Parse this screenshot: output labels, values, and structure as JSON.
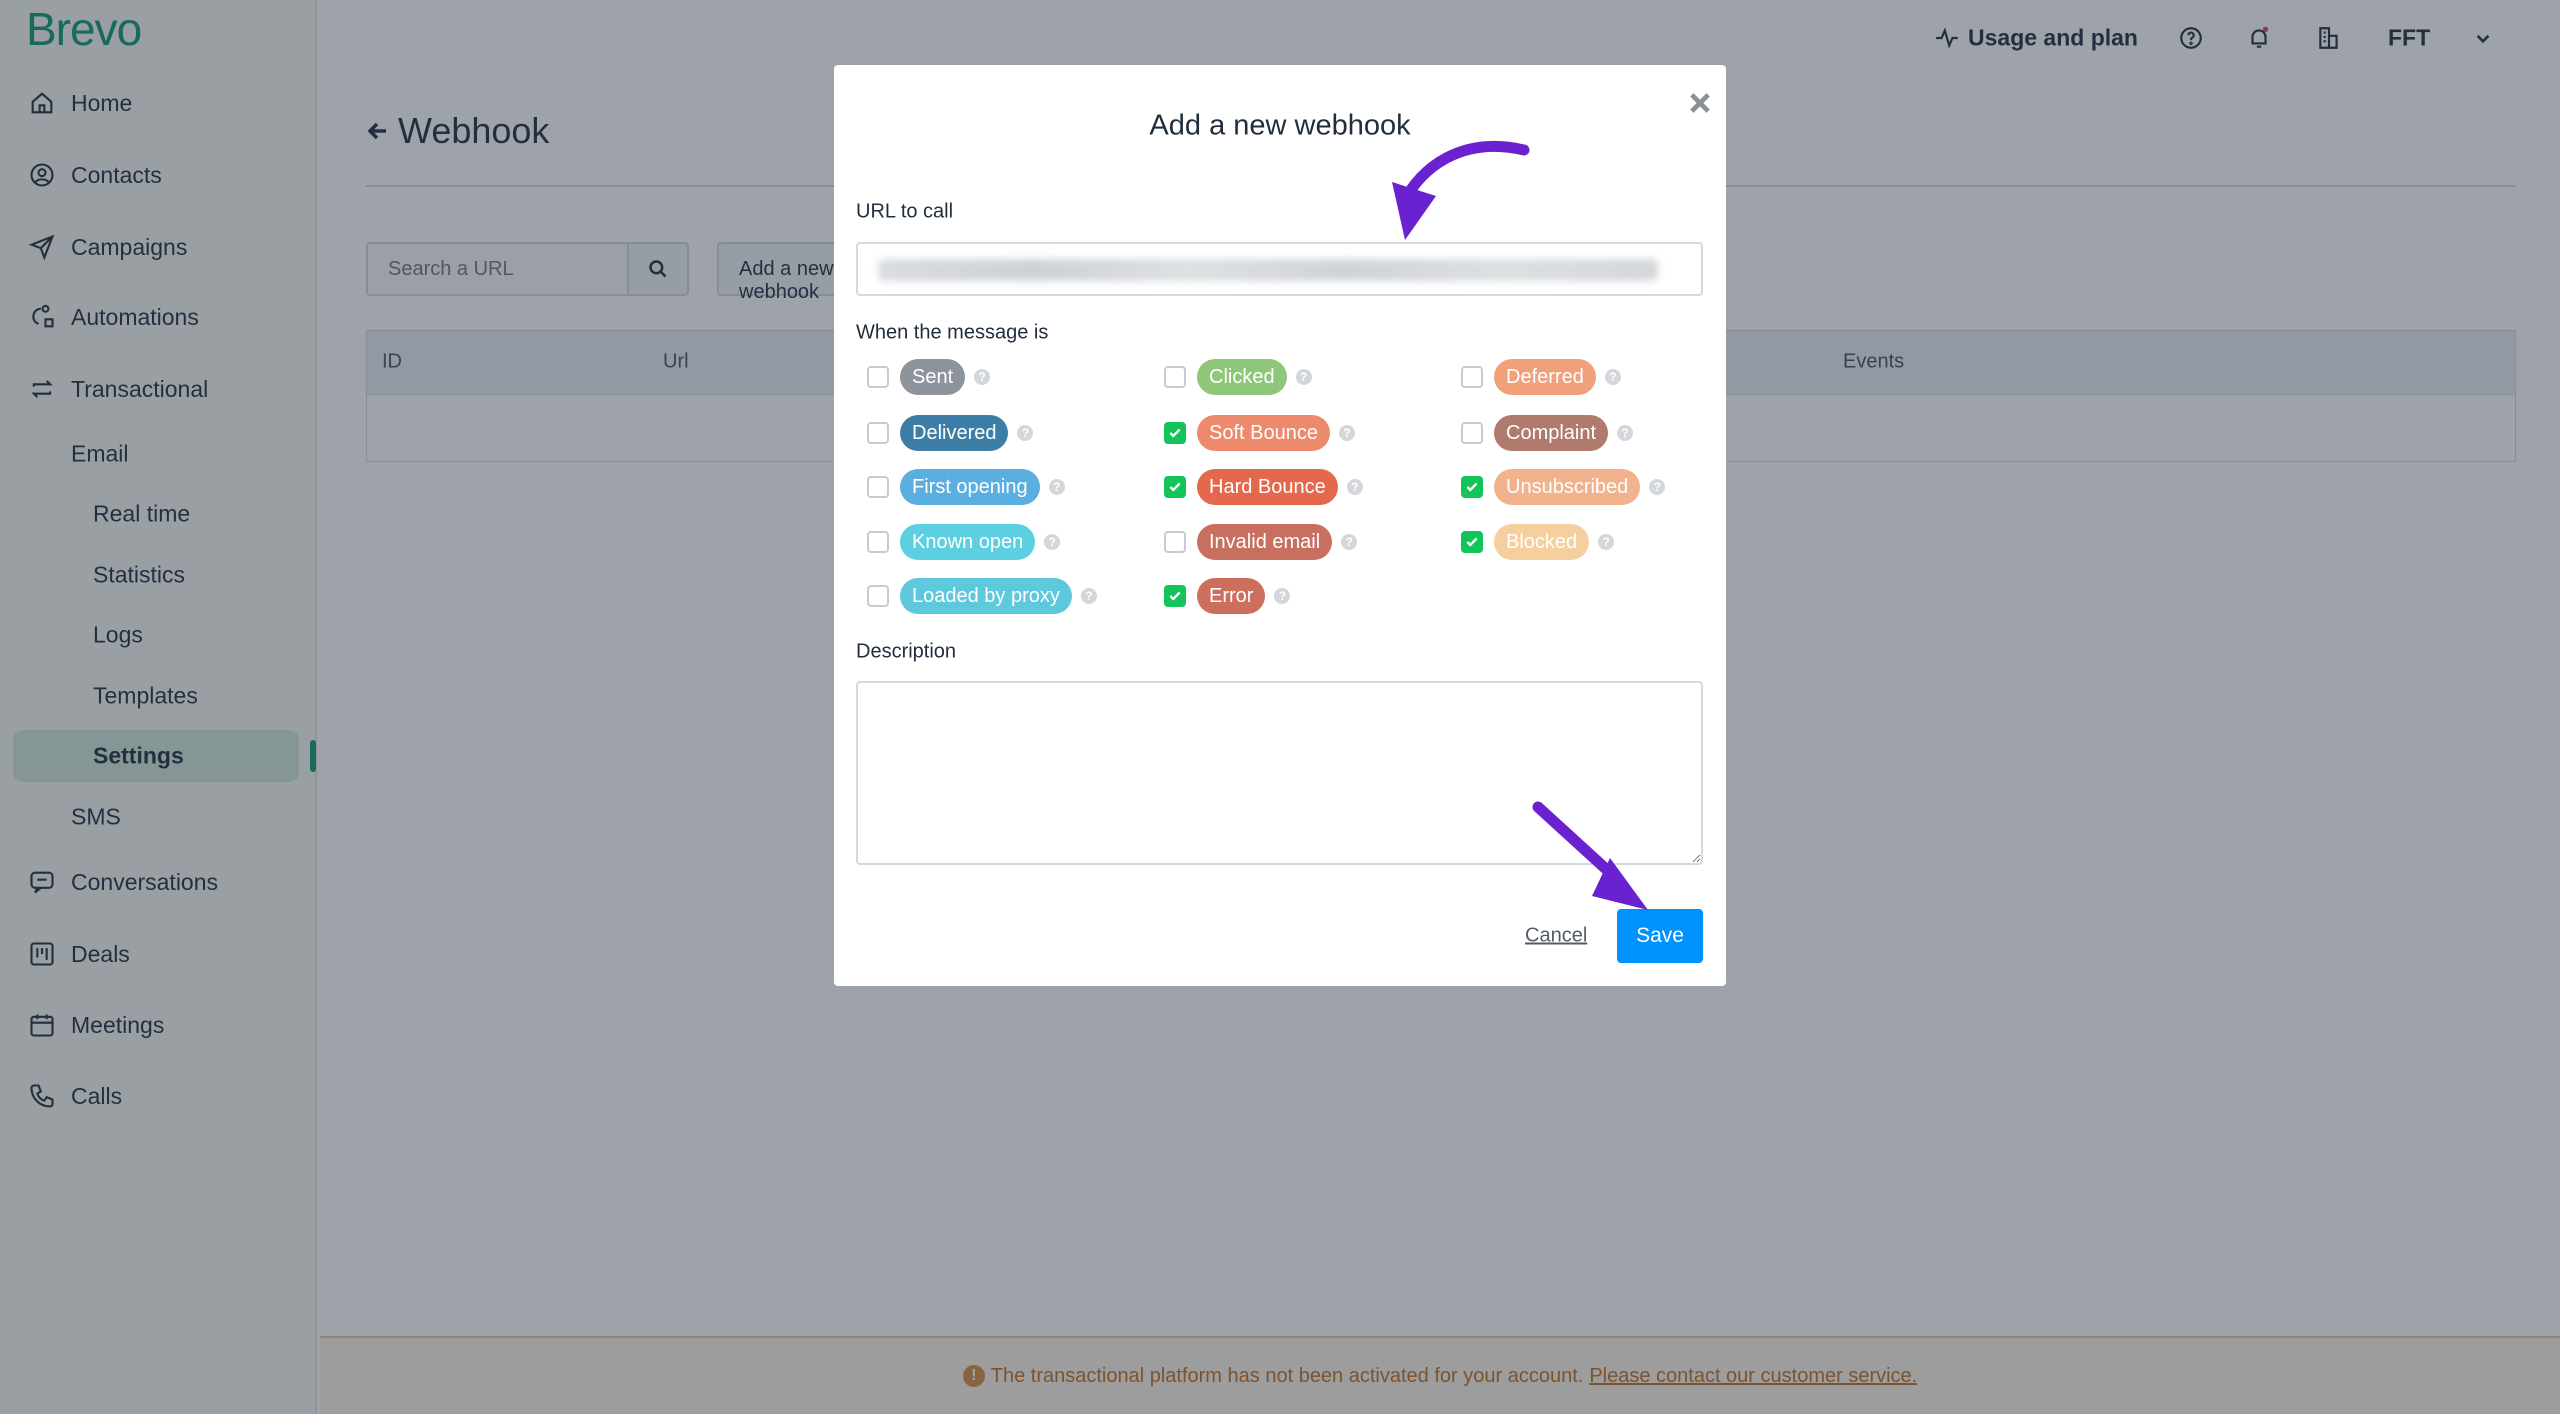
{
  "brand": {
    "logo": "Brevo",
    "accent": "#0b996e"
  },
  "sidebar": {
    "items": [
      {
        "label": "Home",
        "icon": "home-icon"
      },
      {
        "label": "Contacts",
        "icon": "contacts-icon"
      },
      {
        "label": "Campaigns",
        "icon": "send-icon"
      },
      {
        "label": "Automations",
        "icon": "automation-icon"
      },
      {
        "label": "Transactional",
        "icon": "transfer-icon"
      },
      {
        "label": "Conversations",
        "icon": "chat-icon"
      },
      {
        "label": "Deals",
        "icon": "deals-icon"
      },
      {
        "label": "Meetings",
        "icon": "calendar-icon"
      },
      {
        "label": "Calls",
        "icon": "phone-icon"
      }
    ],
    "email": "Email",
    "email_sub": [
      "Real time",
      "Statistics",
      "Logs",
      "Templates",
      "Settings"
    ],
    "active": "Settings",
    "sms": "SMS"
  },
  "header": {
    "usage": "Usage and plan",
    "account": "FFT"
  },
  "page": {
    "title": "Webhook",
    "search_placeholder": "Search a URL",
    "add_button": "Add a new webhook",
    "columns": [
      "ID",
      "Url",
      "Events"
    ]
  },
  "banner": {
    "text": "The transactional platform has not been activated for your account.",
    "link": "Please contact our customer service."
  },
  "modal": {
    "title": "Add a new webhook",
    "url_label": "URL to call",
    "events_label": "When the message is",
    "description_label": "Description",
    "cancel": "Cancel",
    "save": "Save",
    "events": [
      {
        "label": "Sent",
        "checked": false,
        "color": "#8e949c"
      },
      {
        "label": "Clicked",
        "checked": false,
        "color": "#8fc77a"
      },
      {
        "label": "Deferred",
        "checked": false,
        "color": "#f0a07a"
      },
      {
        "label": "Delivered",
        "checked": false,
        "color": "#3d7ea6"
      },
      {
        "label": "Soft Bounce",
        "checked": true,
        "color": "#ee8a6c"
      },
      {
        "label": "Complaint",
        "checked": false,
        "color": "#b07a6e"
      },
      {
        "label": "First opening",
        "checked": false,
        "color": "#5aaee0"
      },
      {
        "label": "Hard Bounce",
        "checked": true,
        "color": "#e4684c"
      },
      {
        "label": "Unsubscribed",
        "checked": true,
        "color": "#f2b28e"
      },
      {
        "label": "Known open",
        "checked": false,
        "color": "#5ccfe0"
      },
      {
        "label": "Invalid email",
        "checked": false,
        "color": "#c87060"
      },
      {
        "label": "Blocked",
        "checked": true,
        "color": "#f6cf9e"
      },
      {
        "label": "Loaded by proxy",
        "checked": false,
        "color": "#5ec8dc"
      },
      {
        "label": "Error",
        "checked": true,
        "color": "#cc6f5c"
      }
    ]
  },
  "annotation_color": "#6a22d0"
}
